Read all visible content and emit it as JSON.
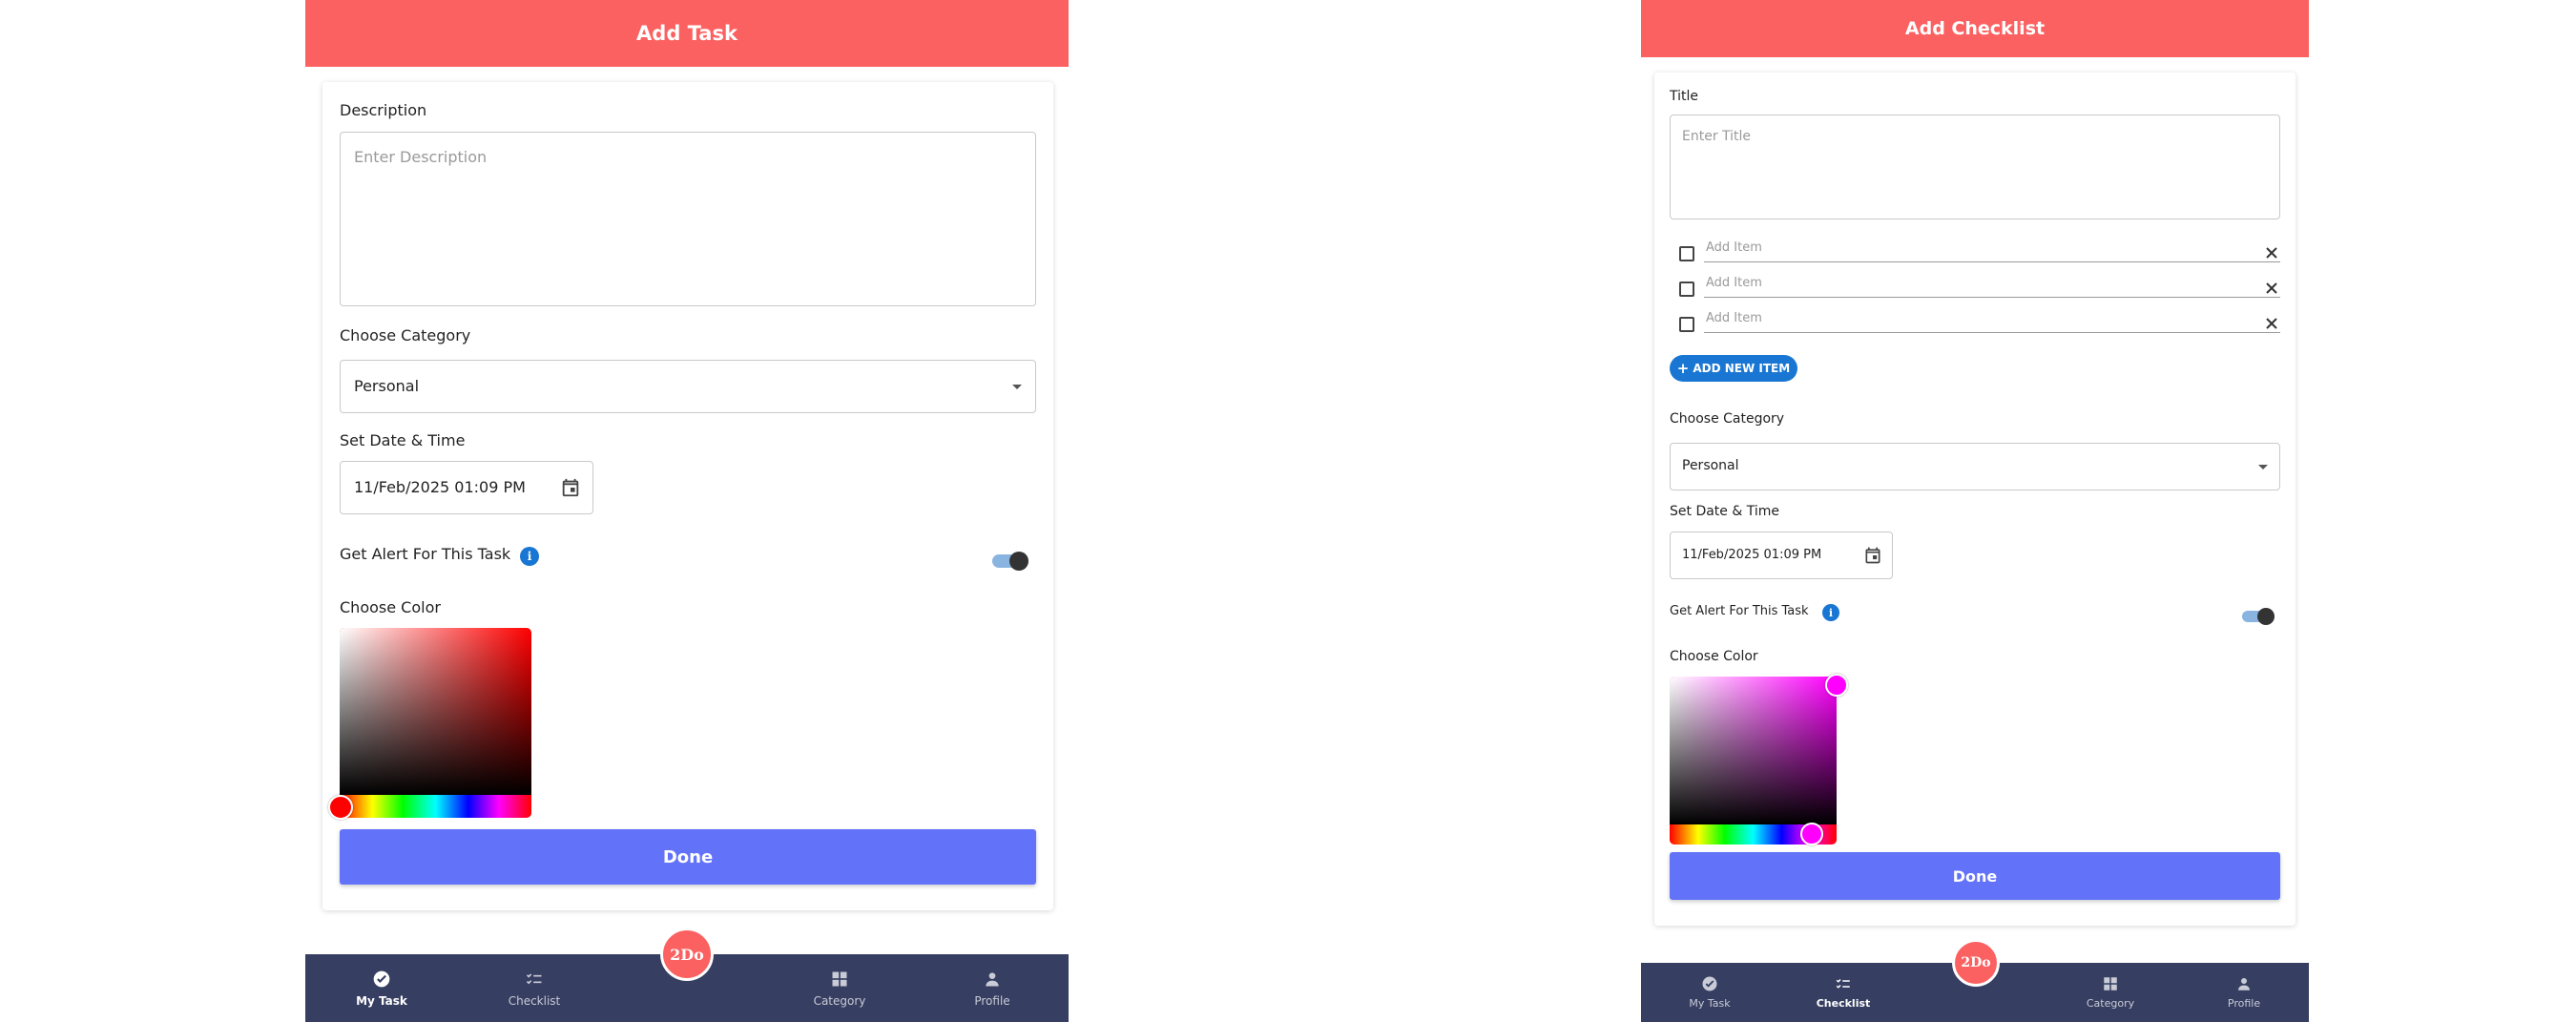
{
  "add_task": {
    "title": "Add Task",
    "description_label": "Description",
    "description_placeholder": "Enter Description",
    "category_label": "Choose Category",
    "category_value": "Personal",
    "datetime_label": "Set Date & Time",
    "datetime_value": "11/Feb/2025 01:09 PM",
    "alert_label": "Get Alert For This Task",
    "alert_enabled": true,
    "color_label": "Choose Color",
    "selected_color": "#ff0000",
    "done_label": "Done"
  },
  "add_checklist": {
    "title": "Add Checklist",
    "title_label": "Title",
    "title_placeholder": "Enter Title",
    "items": [
      {
        "placeholder": "Add Item"
      },
      {
        "placeholder": "Add Item"
      },
      {
        "placeholder": "Add Item"
      }
    ],
    "add_item_label": "ADD NEW ITEM",
    "category_label": "Choose Category",
    "category_value": "Personal",
    "datetime_label": "Set Date & Time",
    "datetime_value": "11/Feb/2025 01:09 PM",
    "alert_label": "Get Alert For This Task",
    "alert_enabled": true,
    "color_label": "Choose Color",
    "selected_color": "#ff00ff",
    "done_label": "Done"
  },
  "nav": {
    "logo": "2Do",
    "items": [
      "My Task",
      "Checklist",
      "Category",
      "Profile"
    ]
  },
  "colors": {
    "header": "#fc6161",
    "button": "#6272f9",
    "navbar": "#363e61",
    "accent": "#1976d2"
  }
}
